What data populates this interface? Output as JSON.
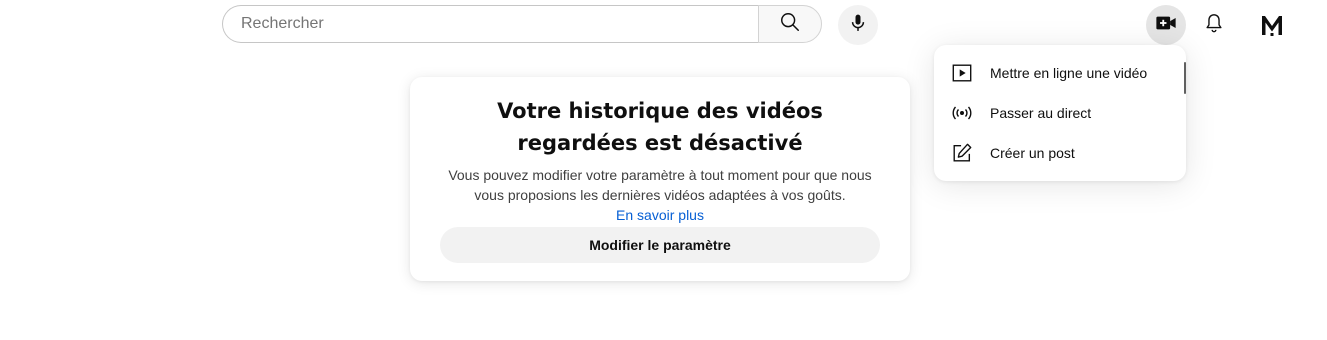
{
  "search": {
    "placeholder": "Rechercher"
  },
  "header": {
    "icons": [
      "search-icon",
      "mic-icon",
      "video-add-icon",
      "bell-icon",
      "avatar"
    ],
    "avatar_initial": "M"
  },
  "create_menu": {
    "items": [
      {
        "icon": "play-square-icon",
        "label": "Mettre en ligne une vidéo"
      },
      {
        "icon": "live-broadcast-icon",
        "label": "Passer au direct"
      },
      {
        "icon": "edit-post-icon",
        "label": "Créer un post"
      }
    ]
  },
  "history_card": {
    "title": "Votre historique des vidéos regardées est désactivé",
    "description": "Vous pouvez modifier votre paramètre à tout moment pour que nous vous proposions les dernières vidéos adaptées à vos goûts.",
    "link": "En savoir plus",
    "button": "Modifier le paramètre"
  },
  "colors": {
    "link": "#065fd4",
    "button_bg": "#f2f2f2",
    "text": "#0f0f0f"
  }
}
